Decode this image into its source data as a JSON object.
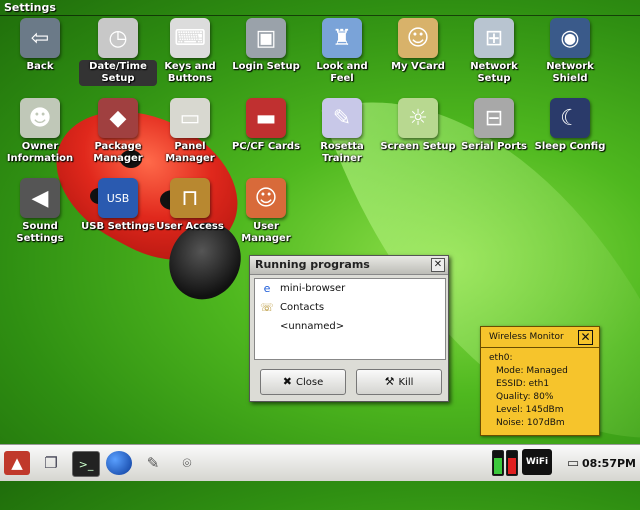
{
  "window": {
    "title": "Settings"
  },
  "apps": [
    {
      "label": "Back",
      "icon": "back-folder-icon",
      "glyph": "⇦",
      "color": "#6b7a88"
    },
    {
      "label": "Date/Time Setup",
      "icon": "clock-icon",
      "glyph": "◷",
      "color": "#c8c8c8",
      "selected": true
    },
    {
      "label": "Keys and Buttons",
      "icon": "keys-icon",
      "glyph": "⌨",
      "color": "#dcdcdc"
    },
    {
      "label": "Login Setup",
      "icon": "computer-icon",
      "glyph": "▣",
      "color": "#9aa2aa"
    },
    {
      "label": "Look and Feel",
      "icon": "tie-icon",
      "glyph": "♜",
      "color": "#7aa3d8"
    },
    {
      "label": "My VCard",
      "icon": "vcard-icon",
      "glyph": "☺",
      "color": "#d8b26a"
    },
    {
      "label": "Network Setup",
      "icon": "network-icon",
      "glyph": "⊞",
      "color": "#b8c4d0"
    },
    {
      "label": "Network Shield",
      "icon": "globe-shield-icon",
      "glyph": "◉",
      "color": "#3a5a8a"
    },
    {
      "label": "Owner Information",
      "icon": "owner-icon",
      "glyph": "☻",
      "color": "#c0c8b8"
    },
    {
      "label": "Package Manager",
      "icon": "package-icon",
      "glyph": "◆",
      "color": "#a04040"
    },
    {
      "label": "Panel Manager",
      "icon": "panel-icon",
      "glyph": "▭",
      "color": "#d8d8d0"
    },
    {
      "label": "PC/CF Cards",
      "icon": "pcmcia-card-icon",
      "glyph": "▬",
      "color": "#c03030"
    },
    {
      "label": "Rosetta Trainer",
      "icon": "pen-icon",
      "glyph": "✎",
      "color": "#c8c8e8"
    },
    {
      "label": "Screen Setup",
      "icon": "lightbulb-icon",
      "glyph": "☼",
      "color": "#b8d890"
    },
    {
      "label": "Serial Ports",
      "icon": "serial-port-icon",
      "glyph": "⊟",
      "color": "#a8a8a8"
    },
    {
      "label": "Sleep Config",
      "icon": "moon-monitor-icon",
      "glyph": "☾",
      "color": "#2a3a6a"
    },
    {
      "label": "Sound Settings",
      "icon": "speaker-icon",
      "glyph": "◀",
      "color": "#555555"
    },
    {
      "label": "USB Settings",
      "icon": "usb-icon",
      "glyph": "USB",
      "color": "#2a5ab0"
    },
    {
      "label": "User Access",
      "icon": "padlock-icon",
      "glyph": "⊓",
      "color": "#b88830"
    },
    {
      "label": "User Manager",
      "icon": "users-icon",
      "glyph": "☺",
      "color": "#d86a3a"
    }
  ],
  "running_dialog": {
    "title": "Running programs",
    "programs": [
      {
        "label": "mini-browser",
        "icon": "browser-icon",
        "glyph": "e"
      },
      {
        "label": "Contacts",
        "icon": "contacts-icon",
        "glyph": "☏"
      },
      {
        "label": "<unnamed>",
        "icon": "",
        "glyph": ""
      }
    ],
    "close_label": "Close",
    "kill_label": "Kill"
  },
  "wireless_monitor": {
    "title": "Wireless Monitor",
    "lines": [
      "eth0:",
      "Mode: Managed",
      "ESSID: eth1",
      "Quality: 80%",
      "Level: 145dBm",
      "Noise: 107dBm"
    ]
  },
  "taskbar": {
    "buttons": [
      "menu-icon",
      "windows-icon",
      "terminal-icon",
      "globe-icon",
      "notepad-icon",
      "camera-icon"
    ],
    "wifi_label": "WiFi",
    "clock": "08:57PM",
    "colors": {
      "battery_green": "#3cc83c",
      "battery_red": "#e02020"
    }
  }
}
